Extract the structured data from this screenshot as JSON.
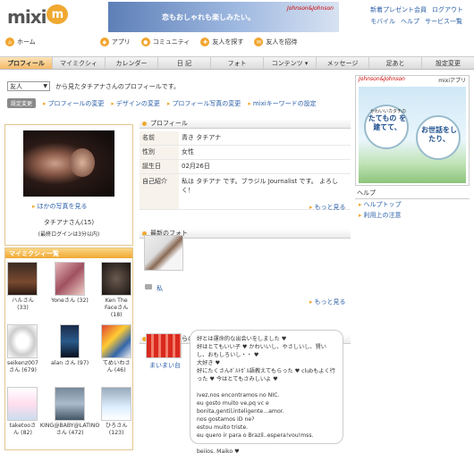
{
  "header": {
    "logo_word": "mixi",
    "logo_mark": "m",
    "banner_text": "恋もおしゃれも楽しみたい。",
    "banner_brand": "Johnson&Johnson",
    "top_links": [
      "新着プレゼント会員",
      "ログアウト",
      "モバイル",
      "ヘルプ",
      "サービス一覧"
    ]
  },
  "global_nav": [
    "ホーム",
    "アプリ",
    "コミュニティ",
    "友人を探す",
    "友人を招待"
  ],
  "tabs": [
    "プロフィール",
    "マイミクシィ",
    "カレンダー",
    "日 記",
    "フォト",
    "コンテンツ ▾",
    "メッセージ",
    "足あと",
    "設定変更"
  ],
  "viewer_select": "友人",
  "viewer_text": "から見たタチアナさんのプロフィールです。",
  "edit_label": "設定変更",
  "edit_links": [
    "プロフィールの変更",
    "デザインの変更",
    "プロフィール写真の変更",
    "mixiキーワードの設定"
  ],
  "left": {
    "more_photos": "ほかの写真を見る",
    "nickname": "タチアナさん(15)",
    "last_login": "(最終ログインは3分以内)",
    "friends_header": "マイミクシィ一覧",
    "friends": [
      {
        "name": "ハルさん (33)"
      },
      {
        "name": "Yoneさん (32)"
      },
      {
        "name": "Ken The Faceさん (18)"
      },
      {
        "name": "seikenz007さん (679)"
      },
      {
        "name": "alan さん (97)"
      },
      {
        "name": "てめいわさん (46)"
      },
      {
        "name": "taketooさん (82)"
      },
      {
        "name": "KING@BABY@LATINOさん (472)"
      },
      {
        "name": "ひろさん (123)"
      }
    ]
  },
  "profile": {
    "header": "プロフィール",
    "rows": [
      {
        "k": "名前",
        "v": "青き タチアナ"
      },
      {
        "k": "性別",
        "v": "女性"
      },
      {
        "k": "誕生日",
        "v": "02月26日"
      },
      {
        "k": "自己紹介",
        "v": "私は タチアナ です。ブラジル Journalist です。 よろしく！"
      }
    ],
    "more": "もっと見る"
  },
  "photos": {
    "header": "最新のフォト",
    "caption": "私",
    "more": "もっと見る"
  },
  "intro": {
    "header": "マイミクからの紹介文",
    "author": "まいまい台",
    "text": "好とは運命的な出会いをしました ♥\n好はとてもいい子 ♥ かわいいし、やさしいし、賢いし、おもしろいし・・ ♥\n大好き ♥\n好にたくさんﾎﾞﾙﾄｶﾞﾙ語教えてもらった ♥ clubもよく行った ♥ 今はとてもさみしいよ ♥\n\nIvez,nos encontramos no NIC.\neu gosto muito ve,pq vc e bonita,gentil,inteligente...amor.\nnos gostamos iD ne?\nestou muito triste.\neu quero ir para o Brazil..espera!vou!mss.\n\nbeijos. Maiko ♥"
  },
  "ad": {
    "brand": "Johnson&Johnson",
    "app_label": "mixiアプリ",
    "circle1_small": "かわいいカタチの",
    "circle1_big": "たてもの を建てて、",
    "circle2_big": "お世話をしたり、"
  },
  "help": {
    "header": "ヘルプ",
    "items": [
      "ヘルプトップ",
      "利用上の注意"
    ]
  },
  "colors": {
    "accent": "#f0a830",
    "link": "#2a5fa8"
  }
}
